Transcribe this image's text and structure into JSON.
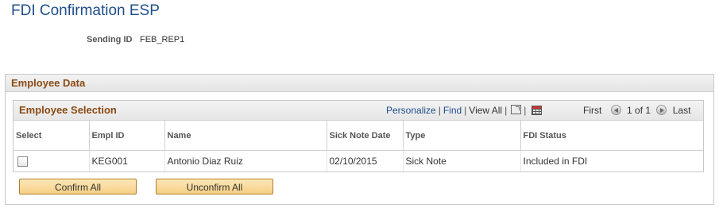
{
  "page": {
    "title": "FDI Confirmation ESP"
  },
  "sending": {
    "label": "Sending ID",
    "value": "FEB_REP1"
  },
  "employee_data": {
    "title": "Employee Data"
  },
  "grid": {
    "title": "Employee Selection",
    "personalize": "Personalize",
    "find": "Find",
    "view_all": "View All",
    "first": "First",
    "range": "1 of 1",
    "last": "Last",
    "columns": [
      "Select",
      "Empl ID",
      "Name",
      "Sick Note Date",
      "Type",
      "FDI Status"
    ],
    "rows": [
      {
        "empl_id": "KEG001",
        "name": "Antonio Diaz Ruiz",
        "sick_note_date": "02/10/2015",
        "type": "Sick Note",
        "fdi_status": "Included in FDI"
      }
    ]
  },
  "buttons": {
    "confirm_all": "Confirm All",
    "unconfirm_all": "Unconfirm All"
  }
}
